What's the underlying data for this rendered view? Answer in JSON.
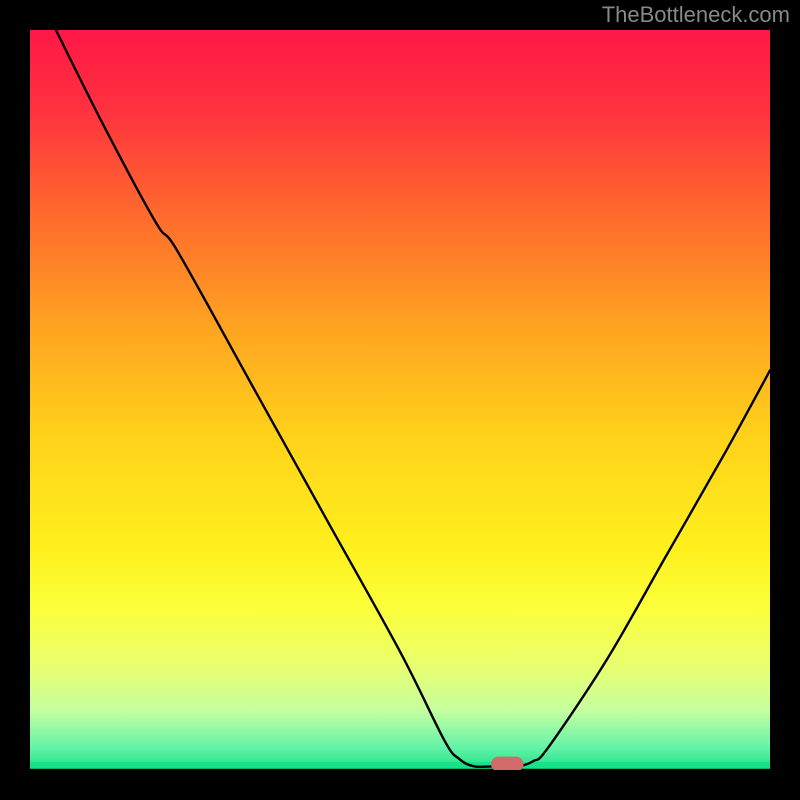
{
  "watermark": "TheBottleneck.com",
  "chart_data": {
    "type": "line",
    "title": "",
    "xlabel": "",
    "ylabel": "",
    "xlim": [
      0,
      100
    ],
    "ylim": [
      0,
      100
    ],
    "gradient_stops": [
      {
        "offset": 0.0,
        "color": "#ff1846"
      },
      {
        "offset": 0.1,
        "color": "#ff2f3f"
      },
      {
        "offset": 0.25,
        "color": "#ff6a2d"
      },
      {
        "offset": 0.4,
        "color": "#ffa321"
      },
      {
        "offset": 0.55,
        "color": "#ffd21a"
      },
      {
        "offset": 0.7,
        "color": "#fff01d"
      },
      {
        "offset": 0.78,
        "color": "#fbff3a"
      },
      {
        "offset": 0.86,
        "color": "#e9ff6f"
      },
      {
        "offset": 0.92,
        "color": "#c4ffa0"
      },
      {
        "offset": 0.97,
        "color": "#63f3a8"
      },
      {
        "offset": 1.0,
        "color": "#18e287"
      }
    ],
    "curve": [
      {
        "x": 3.5,
        "y": 100
      },
      {
        "x": 10,
        "y": 87
      },
      {
        "x": 17,
        "y": 74
      },
      {
        "x": 20,
        "y": 70
      },
      {
        "x": 30,
        "y": 52
      },
      {
        "x": 40,
        "y": 34
      },
      {
        "x": 50,
        "y": 16
      },
      {
        "x": 56,
        "y": 4
      },
      {
        "x": 58,
        "y": 1.5
      },
      {
        "x": 60,
        "y": 0.5
      },
      {
        "x": 63,
        "y": 0.5
      },
      {
        "x": 66,
        "y": 0.5
      },
      {
        "x": 68,
        "y": 1.2
      },
      {
        "x": 70,
        "y": 3
      },
      {
        "x": 78,
        "y": 15
      },
      {
        "x": 86,
        "y": 29
      },
      {
        "x": 94,
        "y": 43
      },
      {
        "x": 100,
        "y": 54
      }
    ],
    "marker": {
      "x": 64.5,
      "y": 0.8,
      "rx": 2.2,
      "ry": 1.0,
      "color": "#d2696b"
    }
  }
}
